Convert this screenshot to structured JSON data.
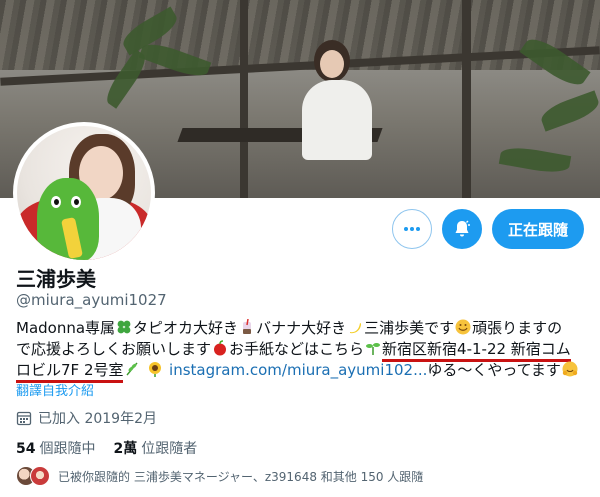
{
  "profile": {
    "display_name": "三浦歩美",
    "handle": "@miura_ayumi1027",
    "follow_button": "正在跟隨"
  },
  "bio": {
    "line1_a": "Madonna専属",
    "line1_b": "タピオカ大好き",
    "line1_c": "バナナ大好き",
    "line1_d": "三浦歩美です",
    "line1_e": "頑張りますの",
    "line2_a": "で応援よろしくお願いします",
    "line2_b": "お手紙などはこちら",
    "addr_1": "新宿区新宿4-1-22 新宿コム",
    "addr_2": "ロビル7F 2号室",
    "link": "instagram.com/miura_ayumi102...",
    "line3_end": "ゆる～くやってます"
  },
  "translate_label": "翻譯自我介紹",
  "joined": "已加入 2019年2月",
  "stats": {
    "following_count": "54",
    "following_label": "個跟隨中",
    "followers_count": "2萬",
    "followers_label": "位跟隨者"
  },
  "followed_by": "已被你跟隨的 三浦歩美マネージャー、z391648 和其他 150 人跟隨",
  "icons": {
    "more": "more-dots-icon",
    "bell": "notification-bell-icon",
    "calendar": "calendar-icon"
  },
  "colors": {
    "accent": "#1d9bf0",
    "underline": "#c91212",
    "link": "#1b6fb3"
  }
}
